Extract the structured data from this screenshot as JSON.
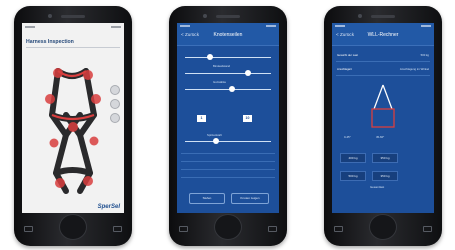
{
  "phone1": {
    "screen_title": "Harness Inspection",
    "brand_logo": "SperSel",
    "harness_color": "#2a2a2c",
    "marker_color": "#d93f3f"
  },
  "phone2": {
    "back_label": "< Zurück",
    "screen_title": "Knotenseilen",
    "label_a": "Bindeabstand",
    "label_b": "Gurtstärke",
    "label_c": "Spitzenkraft",
    "val_1": "1",
    "val_2": "10",
    "button_left": "Stufen",
    "button_right": "Knoten zeigen"
  },
  "phone3": {
    "back_label": "< Zurück",
    "screen_title": "WLL-Rechner",
    "row1_label": "Gewicht der Last",
    "row1_value": "500 kg",
    "row2_label": "Anschlagart",
    "row2_value": "Anschlagung im Winkel",
    "angle_a": "0-45°",
    "angle_b": "45-60°",
    "field_a": "400 kg",
    "field_b": "350 kg",
    "green_a": "500 kg",
    "green_b": "350 kg",
    "total_label": "Gesamtlast"
  },
  "colors": {
    "app_blue": "#1d4f9a",
    "accent_red": "#d93f3f",
    "accent_green": "#4a9a3c"
  }
}
